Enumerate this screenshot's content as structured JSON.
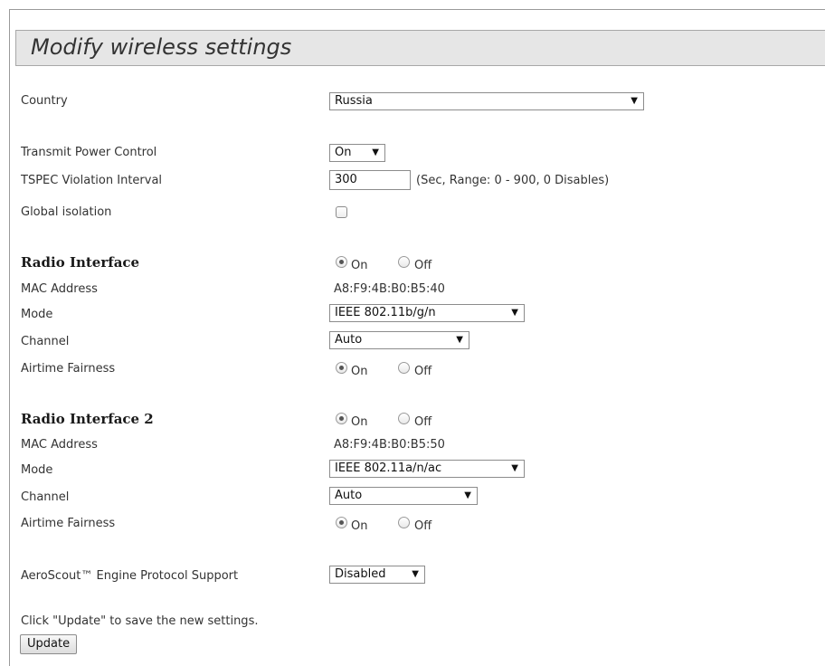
{
  "page": {
    "title": "Modify wireless settings"
  },
  "global": {
    "country_label": "Country",
    "country_value": "Russia",
    "tpc_label": "Transmit Power Control",
    "tpc_value": "On",
    "tspec_label": "TSPEC Violation Interval",
    "tspec_value": "300",
    "tspec_hint": "(Sec, Range: 0 - 900, 0 Disables)",
    "isolation_label": "Global isolation",
    "isolation_checked": false
  },
  "radio1": {
    "heading": "Radio Interface",
    "state": "On",
    "on_label": "On",
    "off_label": "Off",
    "mac_label": "MAC Address",
    "mac_value": "A8:F9:4B:B0:B5:40",
    "mode_label": "Mode",
    "mode_value": "IEEE 802.11b/g/n",
    "channel_label": "Channel",
    "channel_value": "Auto",
    "airtime_label": "Airtime Fairness",
    "airtime_state": "On"
  },
  "radio2": {
    "heading": "Radio Interface 2",
    "state": "On",
    "on_label": "On",
    "off_label": "Off",
    "mac_label": "MAC Address",
    "mac_value": "A8:F9:4B:B0:B5:50",
    "mode_label": "Mode",
    "mode_value": "IEEE 802.11a/n/ac",
    "channel_label": "Channel",
    "channel_value": "Auto",
    "airtime_label": "Airtime Fairness",
    "airtime_state": "On"
  },
  "aeroscout": {
    "label": "AeroScout™ Engine Protocol Support",
    "value": "Disabled"
  },
  "footer": {
    "hint": "Click \"Update\" to save the new settings.",
    "update_label": "Update"
  },
  "icons": {
    "dropdown": "chevron-down-icon"
  }
}
